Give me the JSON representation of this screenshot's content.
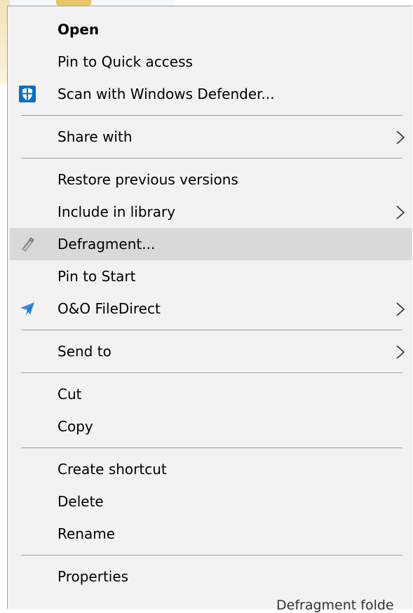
{
  "menu": {
    "open": "Open",
    "pin_quick_access": "Pin to Quick access",
    "scan_defender": "Scan with Windows Defender...",
    "share_with": "Share with",
    "restore_versions": "Restore previous versions",
    "include_library": "Include in library",
    "defragment": "Defragment...",
    "pin_start": "Pin to Start",
    "oo_filedirect": "O&O FileDirect",
    "send_to": "Send to",
    "cut": "Cut",
    "copy": "Copy",
    "create_shortcut": "Create shortcut",
    "delete": "Delete",
    "rename": "Rename",
    "properties": "Properties"
  },
  "tooltip": "Defragment folde",
  "icons": {
    "defender": "shield-icon",
    "defragment": "defrag-icon",
    "filedirect": "paper-plane-icon",
    "submenu": "chevron-right-icon"
  },
  "colors": {
    "menu_bg": "#f2f2f2",
    "highlight": "#d9d9d9",
    "defender_blue": "#0a6fc2",
    "filedirect_blue": "#2f8fe0"
  }
}
